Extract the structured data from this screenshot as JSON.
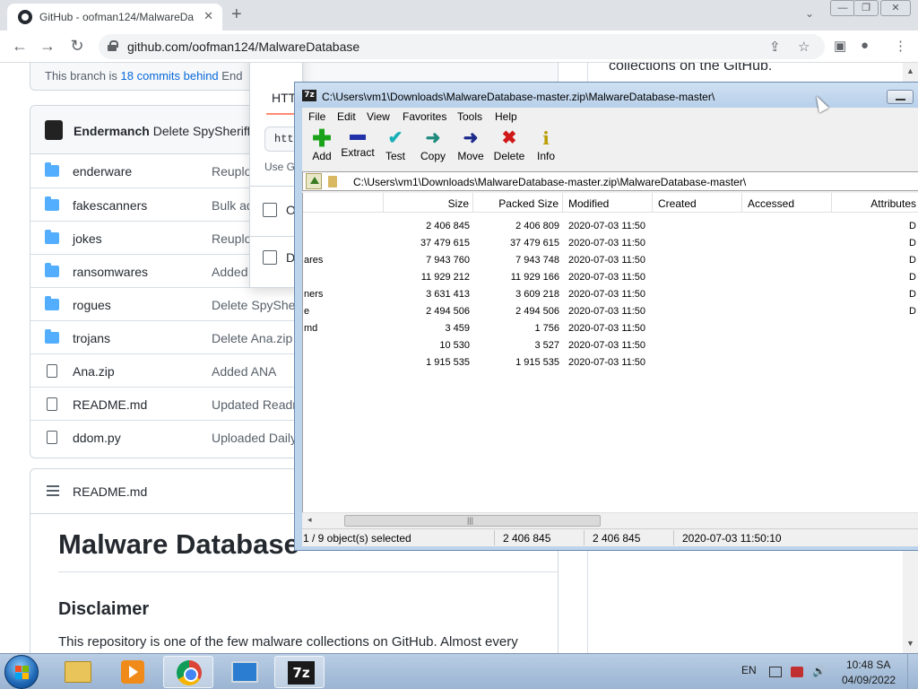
{
  "browser": {
    "tab_title": "GitHub - oofman124/MalwareDa",
    "tab_close": "✕",
    "new_tab": "+",
    "url": "github.com/oofman124/MalwareDatabase",
    "back": "←",
    "forward": "→",
    "reload": "↻"
  },
  "github": {
    "branch_prefix": "This branch is",
    "branch_link": "18 commits behind",
    "branch_suffix": "End",
    "right_text": "collections on the GitHub.",
    "commit_author": "Endermanch",
    "commit_message": "Delete SpySheriff.z",
    "files": [
      {
        "name": "enderware",
        "type": "folder",
        "message": "Reuplo"
      },
      {
        "name": "fakescanners",
        "type": "folder",
        "message": "Bulk ad"
      },
      {
        "name": "jokes",
        "type": "folder",
        "message": "Reuplo"
      },
      {
        "name": "ransomwares",
        "type": "folder",
        "message": "Added"
      },
      {
        "name": "rogues",
        "type": "folder",
        "message": "Delete SpyShe"
      },
      {
        "name": "trojans",
        "type": "folder",
        "message": "Delete Ana.zip"
      },
      {
        "name": "Ana.zip",
        "type": "file",
        "message": "Added ANA"
      },
      {
        "name": "README.md",
        "type": "file",
        "message": "Updated Readr"
      },
      {
        "name": "ddom.py",
        "type": "file",
        "message": "Uploaded Daily"
      }
    ],
    "readme_title": "README.md",
    "readme_h1": "Malware Database",
    "readme_h2": "Disclaimer",
    "readme_p": "This repository is one of the few malware collections on GitHub. Almost every",
    "popup": {
      "tab_label": "HTT",
      "input_value": "htt",
      "small_text": "Use Gi",
      "item1": "O",
      "item2": "D"
    }
  },
  "sevenzip": {
    "title": "C:\\Users\\vm1\\Downloads\\MalwareDatabase-master.zip\\MalwareDatabase-master\\",
    "logo": "7z",
    "menu": [
      "File",
      "Edit",
      "View",
      "Favorites",
      "Tools",
      "Help"
    ],
    "toolbar": [
      {
        "label": "Add",
        "icon": "✚"
      },
      {
        "label": "Extract",
        "icon": ""
      },
      {
        "label": "Test",
        "icon": "✔"
      },
      {
        "label": "Copy",
        "icon": "➜"
      },
      {
        "label": "Move",
        "icon": "➜"
      },
      {
        "label": "Delete",
        "icon": "✖"
      },
      {
        "label": "Info",
        "icon": "i"
      }
    ],
    "path": "C:\\Users\\vm1\\Downloads\\MalwareDatabase-master.zip\\MalwareDatabase-master\\",
    "columns": [
      "Size",
      "Packed Size",
      "Modified",
      "Created",
      "Accessed",
      "Attributes"
    ],
    "rows": [
      {
        "name": "",
        "size": "2 406 845",
        "packed": "2 406 809",
        "modified": "2020-07-03 11:50",
        "attr": "D"
      },
      {
        "name": "",
        "size": "37 479 615",
        "packed": "37 479 615",
        "modified": "2020-07-03 11:50",
        "attr": "D"
      },
      {
        "name": "ares",
        "size": "7 943 760",
        "packed": "7 943 748",
        "modified": "2020-07-03 11:50",
        "attr": "D"
      },
      {
        "name": "",
        "size": "11 929 212",
        "packed": "11 929 166",
        "modified": "2020-07-03 11:50",
        "attr": "D"
      },
      {
        "name": "ners",
        "size": "3 631 413",
        "packed": "3 609 218",
        "modified": "2020-07-03 11:50",
        "attr": "D"
      },
      {
        "name": "e",
        "size": "2 494 506",
        "packed": "2 494 506",
        "modified": "2020-07-03 11:50",
        "attr": "D"
      },
      {
        "name": "md",
        "size": "3 459",
        "packed": "1 756",
        "modified": "2020-07-03 11:50",
        "attr": ""
      },
      {
        "name": "",
        "size": "10 530",
        "packed": "3 527",
        "modified": "2020-07-03 11:50",
        "attr": ""
      },
      {
        "name": "",
        "size": "1 915 535",
        "packed": "1 915 535",
        "modified": "2020-07-03 11:50",
        "attr": ""
      }
    ],
    "status": {
      "selection": "1 / 9 object(s) selected",
      "size": "2 406 845",
      "packed": "2 406 845",
      "modified": "2020-07-03 11:50:10"
    }
  },
  "taskbar": {
    "language": "EN",
    "time": "10:48 SA",
    "date": "04/09/2022",
    "app_7z": "7z"
  }
}
